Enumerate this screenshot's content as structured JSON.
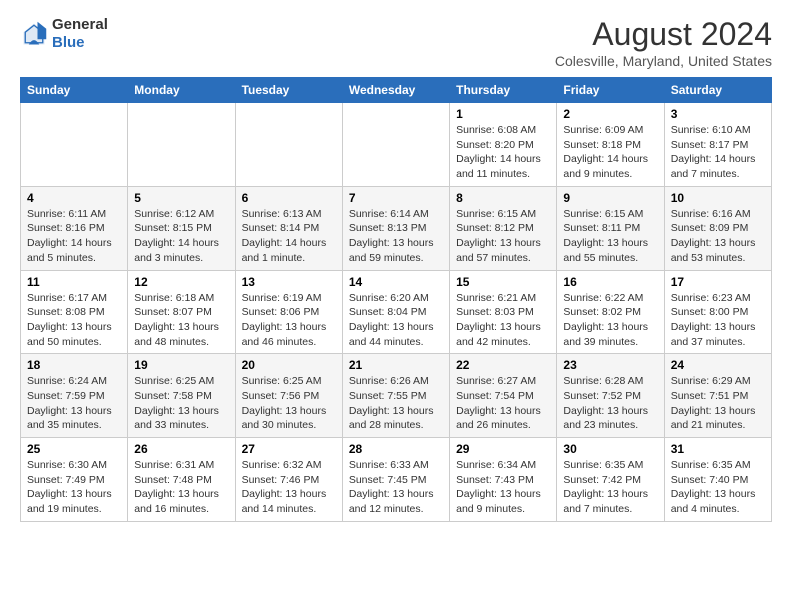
{
  "header": {
    "logo_general": "General",
    "logo_blue": "Blue",
    "month_title": "August 2024",
    "location": "Colesville, Maryland, United States"
  },
  "weekdays": [
    "Sunday",
    "Monday",
    "Tuesday",
    "Wednesday",
    "Thursday",
    "Friday",
    "Saturday"
  ],
  "weeks": [
    [
      {
        "day": "",
        "sunrise": "",
        "sunset": "",
        "daylight": ""
      },
      {
        "day": "",
        "sunrise": "",
        "sunset": "",
        "daylight": ""
      },
      {
        "day": "",
        "sunrise": "",
        "sunset": "",
        "daylight": ""
      },
      {
        "day": "",
        "sunrise": "",
        "sunset": "",
        "daylight": ""
      },
      {
        "day": "1",
        "sunrise": "Sunrise: 6:08 AM",
        "sunset": "Sunset: 8:20 PM",
        "daylight": "Daylight: 14 hours and 11 minutes."
      },
      {
        "day": "2",
        "sunrise": "Sunrise: 6:09 AM",
        "sunset": "Sunset: 8:18 PM",
        "daylight": "Daylight: 14 hours and 9 minutes."
      },
      {
        "day": "3",
        "sunrise": "Sunrise: 6:10 AM",
        "sunset": "Sunset: 8:17 PM",
        "daylight": "Daylight: 14 hours and 7 minutes."
      }
    ],
    [
      {
        "day": "4",
        "sunrise": "Sunrise: 6:11 AM",
        "sunset": "Sunset: 8:16 PM",
        "daylight": "Daylight: 14 hours and 5 minutes."
      },
      {
        "day": "5",
        "sunrise": "Sunrise: 6:12 AM",
        "sunset": "Sunset: 8:15 PM",
        "daylight": "Daylight: 14 hours and 3 minutes."
      },
      {
        "day": "6",
        "sunrise": "Sunrise: 6:13 AM",
        "sunset": "Sunset: 8:14 PM",
        "daylight": "Daylight: 14 hours and 1 minute."
      },
      {
        "day": "7",
        "sunrise": "Sunrise: 6:14 AM",
        "sunset": "Sunset: 8:13 PM",
        "daylight": "Daylight: 13 hours and 59 minutes."
      },
      {
        "day": "8",
        "sunrise": "Sunrise: 6:15 AM",
        "sunset": "Sunset: 8:12 PM",
        "daylight": "Daylight: 13 hours and 57 minutes."
      },
      {
        "day": "9",
        "sunrise": "Sunrise: 6:15 AM",
        "sunset": "Sunset: 8:11 PM",
        "daylight": "Daylight: 13 hours and 55 minutes."
      },
      {
        "day": "10",
        "sunrise": "Sunrise: 6:16 AM",
        "sunset": "Sunset: 8:09 PM",
        "daylight": "Daylight: 13 hours and 53 minutes."
      }
    ],
    [
      {
        "day": "11",
        "sunrise": "Sunrise: 6:17 AM",
        "sunset": "Sunset: 8:08 PM",
        "daylight": "Daylight: 13 hours and 50 minutes."
      },
      {
        "day": "12",
        "sunrise": "Sunrise: 6:18 AM",
        "sunset": "Sunset: 8:07 PM",
        "daylight": "Daylight: 13 hours and 48 minutes."
      },
      {
        "day": "13",
        "sunrise": "Sunrise: 6:19 AM",
        "sunset": "Sunset: 8:06 PM",
        "daylight": "Daylight: 13 hours and 46 minutes."
      },
      {
        "day": "14",
        "sunrise": "Sunrise: 6:20 AM",
        "sunset": "Sunset: 8:04 PM",
        "daylight": "Daylight: 13 hours and 44 minutes."
      },
      {
        "day": "15",
        "sunrise": "Sunrise: 6:21 AM",
        "sunset": "Sunset: 8:03 PM",
        "daylight": "Daylight: 13 hours and 42 minutes."
      },
      {
        "day": "16",
        "sunrise": "Sunrise: 6:22 AM",
        "sunset": "Sunset: 8:02 PM",
        "daylight": "Daylight: 13 hours and 39 minutes."
      },
      {
        "day": "17",
        "sunrise": "Sunrise: 6:23 AM",
        "sunset": "Sunset: 8:00 PM",
        "daylight": "Daylight: 13 hours and 37 minutes."
      }
    ],
    [
      {
        "day": "18",
        "sunrise": "Sunrise: 6:24 AM",
        "sunset": "Sunset: 7:59 PM",
        "daylight": "Daylight: 13 hours and 35 minutes."
      },
      {
        "day": "19",
        "sunrise": "Sunrise: 6:25 AM",
        "sunset": "Sunset: 7:58 PM",
        "daylight": "Daylight: 13 hours and 33 minutes."
      },
      {
        "day": "20",
        "sunrise": "Sunrise: 6:25 AM",
        "sunset": "Sunset: 7:56 PM",
        "daylight": "Daylight: 13 hours and 30 minutes."
      },
      {
        "day": "21",
        "sunrise": "Sunrise: 6:26 AM",
        "sunset": "Sunset: 7:55 PM",
        "daylight": "Daylight: 13 hours and 28 minutes."
      },
      {
        "day": "22",
        "sunrise": "Sunrise: 6:27 AM",
        "sunset": "Sunset: 7:54 PM",
        "daylight": "Daylight: 13 hours and 26 minutes."
      },
      {
        "day": "23",
        "sunrise": "Sunrise: 6:28 AM",
        "sunset": "Sunset: 7:52 PM",
        "daylight": "Daylight: 13 hours and 23 minutes."
      },
      {
        "day": "24",
        "sunrise": "Sunrise: 6:29 AM",
        "sunset": "Sunset: 7:51 PM",
        "daylight": "Daylight: 13 hours and 21 minutes."
      }
    ],
    [
      {
        "day": "25",
        "sunrise": "Sunrise: 6:30 AM",
        "sunset": "Sunset: 7:49 PM",
        "daylight": "Daylight: 13 hours and 19 minutes."
      },
      {
        "day": "26",
        "sunrise": "Sunrise: 6:31 AM",
        "sunset": "Sunset: 7:48 PM",
        "daylight": "Daylight: 13 hours and 16 minutes."
      },
      {
        "day": "27",
        "sunrise": "Sunrise: 6:32 AM",
        "sunset": "Sunset: 7:46 PM",
        "daylight": "Daylight: 13 hours and 14 minutes."
      },
      {
        "day": "28",
        "sunrise": "Sunrise: 6:33 AM",
        "sunset": "Sunset: 7:45 PM",
        "daylight": "Daylight: 13 hours and 12 minutes."
      },
      {
        "day": "29",
        "sunrise": "Sunrise: 6:34 AM",
        "sunset": "Sunset: 7:43 PM",
        "daylight": "Daylight: 13 hours and 9 minutes."
      },
      {
        "day": "30",
        "sunrise": "Sunrise: 6:35 AM",
        "sunset": "Sunset: 7:42 PM",
        "daylight": "Daylight: 13 hours and 7 minutes."
      },
      {
        "day": "31",
        "sunrise": "Sunrise: 6:35 AM",
        "sunset": "Sunset: 7:40 PM",
        "daylight": "Daylight: 13 hours and 4 minutes."
      }
    ]
  ]
}
